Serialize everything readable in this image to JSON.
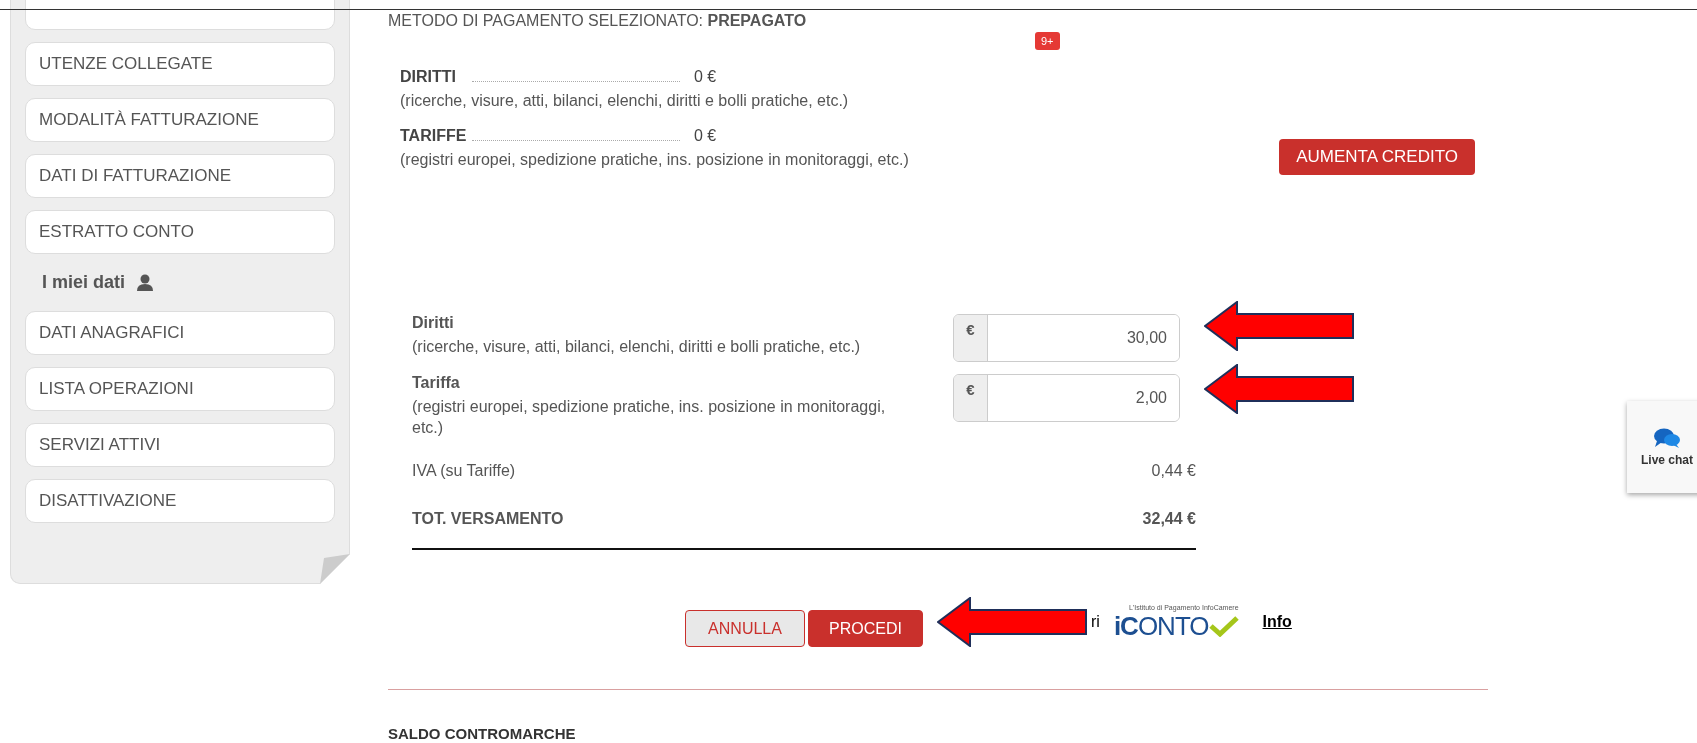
{
  "sidebar": {
    "items": [
      {
        "label": "UTENZE COLLEGATE"
      },
      {
        "label": "MODALITÀ FATTURAZIONE"
      },
      {
        "label": "DATI DI FATTURAZIONE"
      },
      {
        "label": "ESTRATTO CONTO"
      }
    ],
    "section_title": "I miei dati",
    "section_items": [
      {
        "label": "DATI ANAGRAFICI"
      },
      {
        "label": "LISTA OPERAZIONI"
      },
      {
        "label": "SERVIZI ATTIVI"
      },
      {
        "label": "DISATTIVAZIONE"
      }
    ]
  },
  "payment_method": {
    "label": "METODO DI PAGAMENTO SELEZIONATO: ",
    "value": "PREPAGATO"
  },
  "badge": "9+",
  "credit": [
    {
      "name": "DIRITTI",
      "amount": "0 €",
      "description": "(ricerche, visure, atti, bilanci, elenchi, diritti e bolli pratiche, etc.)"
    },
    {
      "name": "TARIFFE",
      "amount": "0 €",
      "description": "(registri europei, spedizione pratiche, ins. posizione in monitoraggi, etc.)"
    }
  ],
  "increase_credit_button": "AUMENTA CREDITO",
  "form": [
    {
      "label": "Diritti",
      "description": "(ricerche, visure, atti, bilanci, elenchi, diritti e bolli pratiche, etc.)",
      "currency": "€",
      "value": "30,00"
    },
    {
      "label": "Tariffa",
      "description": "(registri europei, spedizione pratiche, ins. posizione in monitoraggi, etc.)",
      "currency": "€",
      "value": "2,00"
    }
  ],
  "vat": {
    "label": "IVA (su Tariffe)",
    "value": "0,44 €"
  },
  "total": {
    "label": "TOT. VERSAMENTO",
    "value": "32,44 €"
  },
  "buttons": {
    "cancel": "ANNULLA",
    "proceed": "PROCEDI"
  },
  "covered_text": "ri",
  "logo": {
    "tagline": "L'Istituto di Pagamento InfoCamere",
    "name_bold": "iC",
    "name_rest": "ONTO"
  },
  "info_link": "Info",
  "next_section": "SALDO CONTROMARCHE",
  "live_chat": "Live chat"
}
